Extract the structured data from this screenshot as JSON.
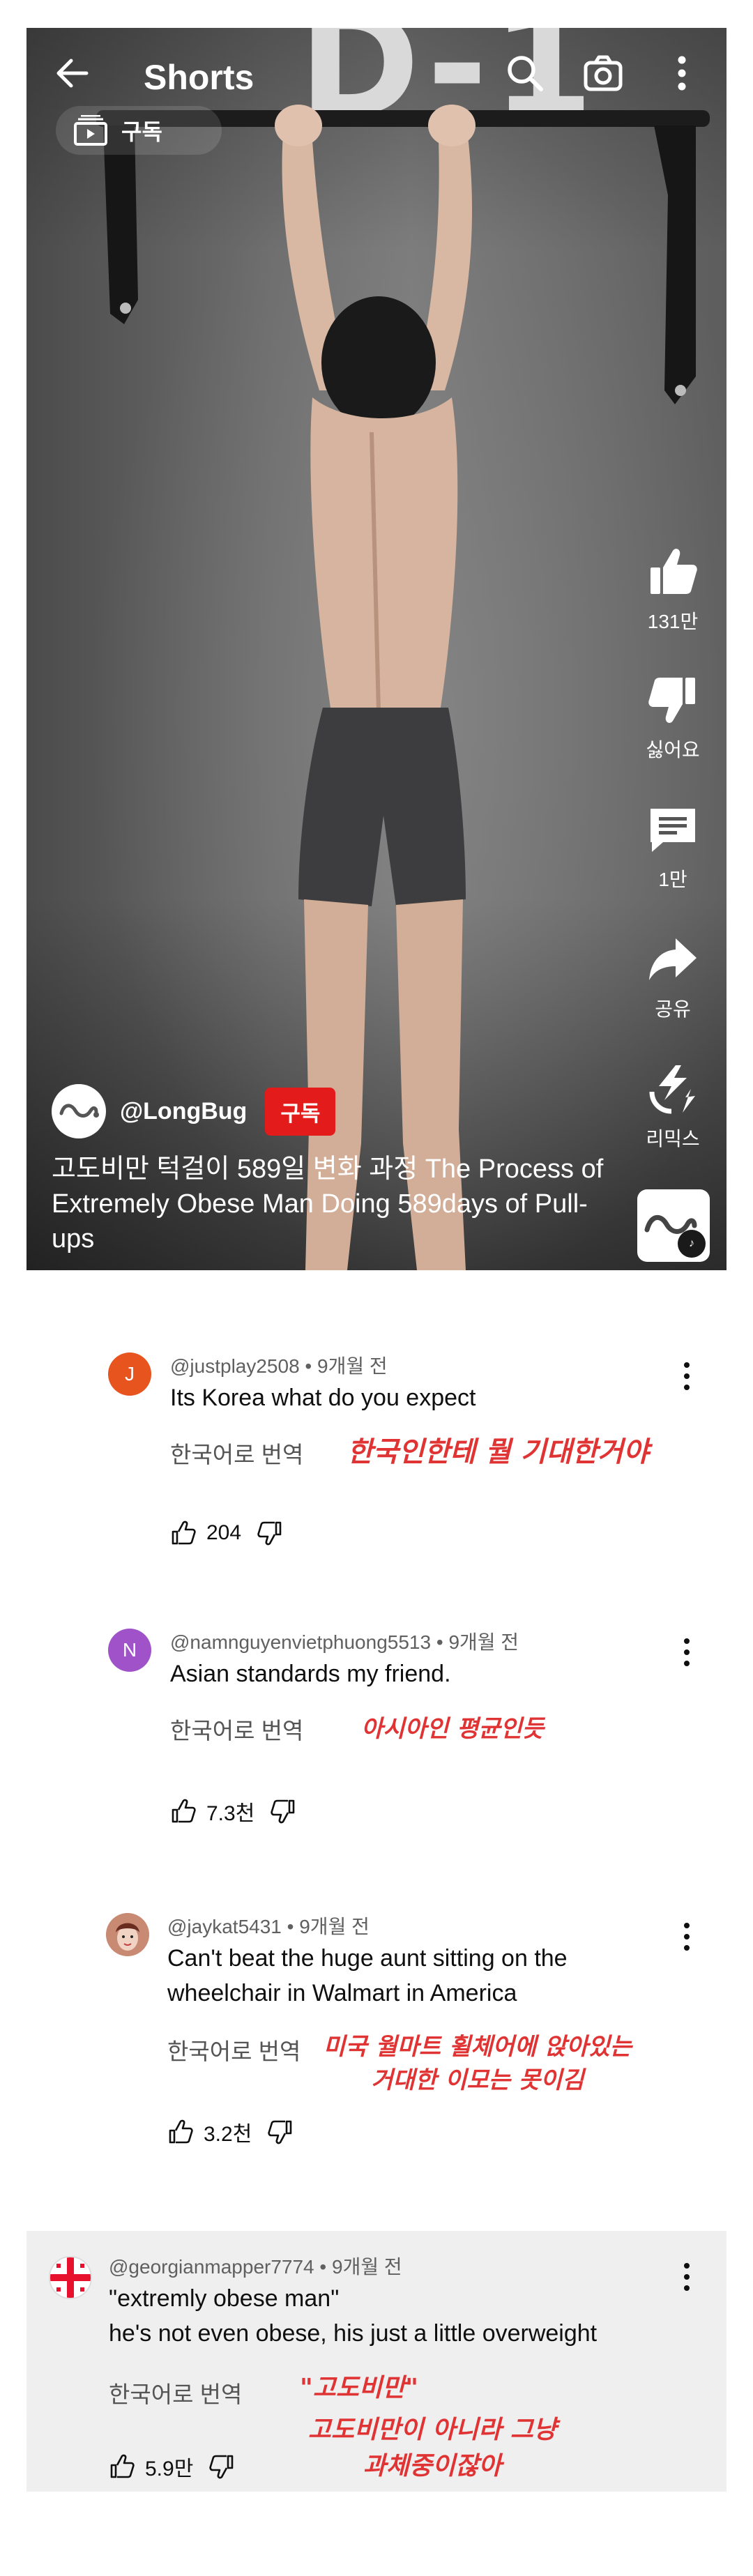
{
  "header": {
    "title": "Shorts",
    "subscriptions_chip": "구독"
  },
  "video": {
    "wall_text": "D-1",
    "likes": "131만",
    "dislike_label": "싫어요",
    "comments": "1만",
    "share_label": "공유",
    "remix_label": "리믹스",
    "channel": "@LongBug",
    "subscribe_label": "구독",
    "title": "고도비만 턱걸이 589일 변화 과정 The Process of Extremely Obese Man Doing 589days of Pull-ups"
  },
  "comments": [
    {
      "avatar_letter": "J",
      "avatar_color": "#e8541e",
      "author": "@justplay2508",
      "time": "9개월 전",
      "text": "Its Korea what do you expect",
      "translate_label": "한국어로 번역",
      "annotation": "한국인한테 뭘 기대한거야",
      "likes": "204"
    },
    {
      "avatar_letter": "N",
      "avatar_color": "#a052c8",
      "author": "@namnguyenvietphuong5513",
      "time": "9개월 전",
      "text": "Asian standards my friend.",
      "translate_label": "한국어로 번역",
      "annotation": "아시아인 평균인듯",
      "likes": "7.3천"
    },
    {
      "avatar_letter": "",
      "avatar_color": "#d9a58e",
      "author": "@jaykat5431",
      "time": "9개월 전",
      "text": "Can't beat the huge aunt sitting on the wheelchair in Walmart in America",
      "translate_label": "한국어로 번역",
      "annotation_line1": "미국 월마트 휠체어에 앉아있는",
      "annotation_line2": "거대한 이모는 못이김",
      "likes": "3.2천"
    },
    {
      "avatar_letter": "",
      "avatar_color": "#ffffff",
      "author": "@georgianmapper7774",
      "time": "9개월 전",
      "text_line1": "\"extremly obese man\"",
      "text_line2": "he's not even obese, his just a little overweight",
      "translate_label": "한국어로 번역",
      "annotation_quote": "\"고도비만\"",
      "annotation_line1": "고도비만이 아니라 그냥",
      "annotation_line2": "과체중이잖아",
      "likes": "5.9만"
    }
  ],
  "icons": {
    "back": "back-arrow-icon",
    "search": "search-icon",
    "camera": "camera-icon",
    "more": "more-vert-icon",
    "like": "thumb-up-icon",
    "dislike": "thumb-down-icon",
    "comment": "comment-icon",
    "share": "share-icon",
    "remix": "remix-icon"
  },
  "colors": {
    "subscribe_red": "#e31b1b",
    "annotation_red": "#e03434",
    "highlight_bg": "#efefef"
  }
}
